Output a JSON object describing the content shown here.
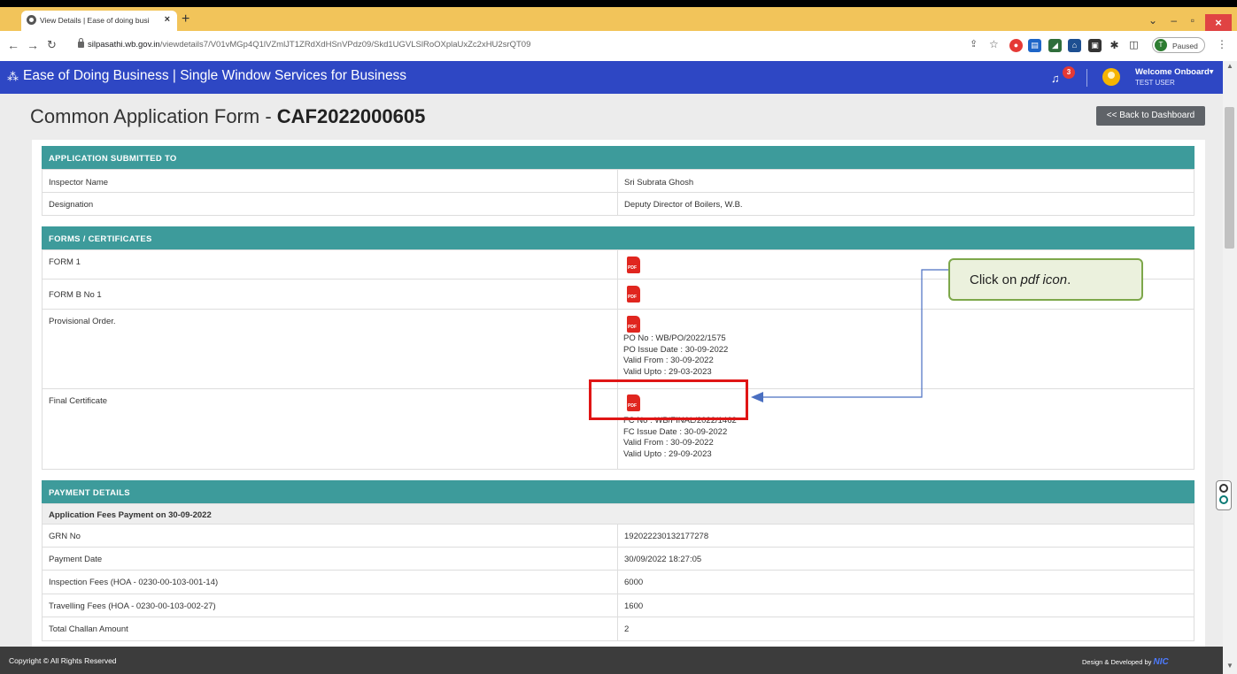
{
  "browser": {
    "tab_title": "View Details | Ease of doing busi",
    "url_host": "silpasathi.wb.gov.in",
    "url_path": "/viewdetails7/V01vMGp4Q1lVZmlJT1ZRdXdHSnVPdz09/Skd1UGVLSlRoOXplaUxZc2xHU2srQT09",
    "profile_initial": "T",
    "profile_status": "Paused"
  },
  "header": {
    "title": "Ease of Doing Business | Single Window Services for Business",
    "notification_count": "3",
    "welcome": "Welcome Onboard",
    "username": "TEST USER"
  },
  "page": {
    "title_prefix": "Common Application Form - ",
    "title_id": "CAF2022000605",
    "back_button": "<< Back to Dashboard"
  },
  "submitted_to": {
    "header": "APPLICATION SUBMITTED TO",
    "rows": [
      {
        "label": "Inspector Name",
        "value": "Sri Subrata Ghosh"
      },
      {
        "label": "Designation",
        "value": "Deputy Director of Boilers, W.B."
      }
    ]
  },
  "forms": {
    "header": "FORMS / CERTIFICATES",
    "pdf_label": "PDF",
    "items": [
      {
        "label": "FORM 1",
        "details": []
      },
      {
        "label": "FORM B No 1",
        "details": []
      },
      {
        "label": "Provisional Order.",
        "details": [
          "PO No : WB/PO/2022/1575",
          "PO Issue Date : 30-09-2022",
          "Valid From : 30-09-2022",
          "Valid Upto : 29-03-2023"
        ]
      },
      {
        "label": "Final Certificate",
        "details": [
          "FC No : WB/FINAL/2022/1462",
          "FC Issue Date : 30-09-2022",
          "Valid From : 30-09-2022",
          "Valid Upto : 29-09-2023"
        ]
      }
    ]
  },
  "payment": {
    "header": "PAYMENT DETAILS",
    "subheader": "Application Fees Payment on 30-09-2022",
    "rows": [
      {
        "label": "GRN No",
        "value": "192022230132177278"
      },
      {
        "label": "Payment Date",
        "value": "30/09/2022 18:27:05"
      },
      {
        "label": "Inspection Fees (HOA - 0230-00-103-001-14)",
        "value": "6000"
      },
      {
        "label": "Travelling Fees (HOA - 0230-00-103-002-27)",
        "value": "1600"
      },
      {
        "label": "Total Challan Amount",
        "value": "2"
      }
    ]
  },
  "annotation": {
    "text_prefix": "Click on ",
    "text_em": "pdf icon",
    "text_suffix": "."
  },
  "footer": {
    "left": "Copyright © All Rights Reserved",
    "right": "Design & Developed by",
    "logo": "NIC"
  }
}
